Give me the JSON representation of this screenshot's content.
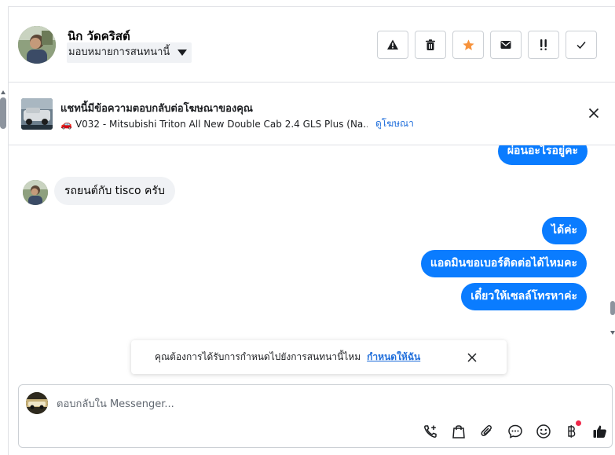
{
  "contact": {
    "name": "นิก วัดคริสต์",
    "assign_label": "มอบหมายการสนทนานี้"
  },
  "header_actions": [
    {
      "icon": "warning-icon"
    },
    {
      "icon": "trash-icon"
    },
    {
      "icon": "star-icon"
    },
    {
      "icon": "envelope-icon"
    },
    {
      "icon": "follow-up-icon"
    },
    {
      "icon": "check-icon"
    }
  ],
  "ad": {
    "title": "แชทนี้มีข้อความตอบกลับต่อโฆษณาของคุณ",
    "vehicle_emoji": "🚗",
    "subtitle": "V032 - Mitsubishi Triton All New Double Cab 2.4 GLS Plus (Na...",
    "link": "ดูโฆษณา"
  },
  "messages": {
    "partial_out": "ผ่อนอะไรอยู่คะ",
    "incoming": "รถยนต์กับ tisco ครับ",
    "outgoing": [
      "ได้ค่ะ",
      "แอดมินขอเบอร์ติดต่อได้ไหมคะ",
      "เดี๋ยวให้เซลล์โทรหาค่ะ"
    ]
  },
  "toast": {
    "text": "คุณต้องการได้รับการกำหนดไปยังการสนทนานี้ไหม",
    "link": "กำหนดให้ฉัน"
  },
  "composer": {
    "placeholder": "ตอบกลับใน Messenger...",
    "tools": [
      "phone-plus-icon",
      "shopping-bag-icon",
      "paperclip-icon",
      "chat-bubble-icon",
      "emoji-icon",
      "baht-icon",
      "thumbs-up-icon"
    ]
  },
  "colors": {
    "accent": "#0a7cff",
    "link": "#216fdb",
    "star": "#f7923b",
    "badge": "#f0284a"
  }
}
